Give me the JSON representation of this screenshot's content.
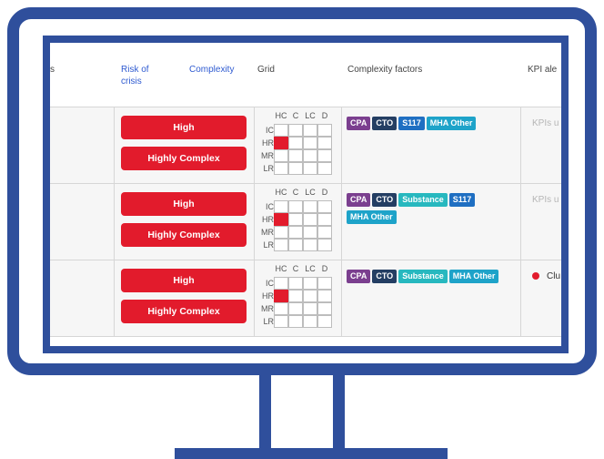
{
  "header": {
    "cut_label": "s",
    "risk_label_line1": "Risk of",
    "risk_label_line2": "crisis",
    "complexity_label": "Complexity",
    "grid_label": "Grid",
    "complexity_factors_label": "Complexity factors",
    "kpi_label": "KPI ale"
  },
  "grid": {
    "columns": [
      "HC",
      "C",
      "LC",
      "D"
    ],
    "rows": [
      "IC",
      "HR",
      "MR",
      "LR"
    ],
    "highlighted": {
      "row": "HR",
      "column": "HC"
    }
  },
  "rows": [
    {
      "risk": "High",
      "complexity": "Highly Complex",
      "tags": [
        {
          "label": "CPA",
          "color": "#7b3f8f"
        },
        {
          "label": "CTO",
          "color": "#243e63"
        },
        {
          "label": "S117",
          "color": "#1f6fc2"
        },
        {
          "label": "MHA Other",
          "color": "#1ea3c9"
        }
      ],
      "kpi": "KPIs u",
      "kpi_dot": false
    },
    {
      "risk": "High",
      "complexity": "Highly Complex",
      "tags": [
        {
          "label": "CPA",
          "color": "#7b3f8f"
        },
        {
          "label": "CTO",
          "color": "#243e63"
        },
        {
          "label": "Substance",
          "color": "#27b8bf"
        },
        {
          "label": "S117",
          "color": "#1f6fc2"
        },
        {
          "label": "MHA Other",
          "color": "#1ea3c9"
        }
      ],
      "kpi": "KPIs u",
      "kpi_dot": false
    },
    {
      "risk": "High",
      "complexity": "Highly Complex",
      "tags": [
        {
          "label": "CPA",
          "color": "#7b3f8f"
        },
        {
          "label": "CTO",
          "color": "#243e63"
        },
        {
          "label": "Substance",
          "color": "#27b8bf"
        },
        {
          "label": "MHA Other",
          "color": "#1ea3c9"
        }
      ],
      "kpi": "Clu",
      "kpi_dot": true
    }
  ],
  "colors": {
    "monitor_blue": "#2f4f9c",
    "risk_red": "#e21b2c",
    "header_link_blue": "#2f5bd1"
  }
}
